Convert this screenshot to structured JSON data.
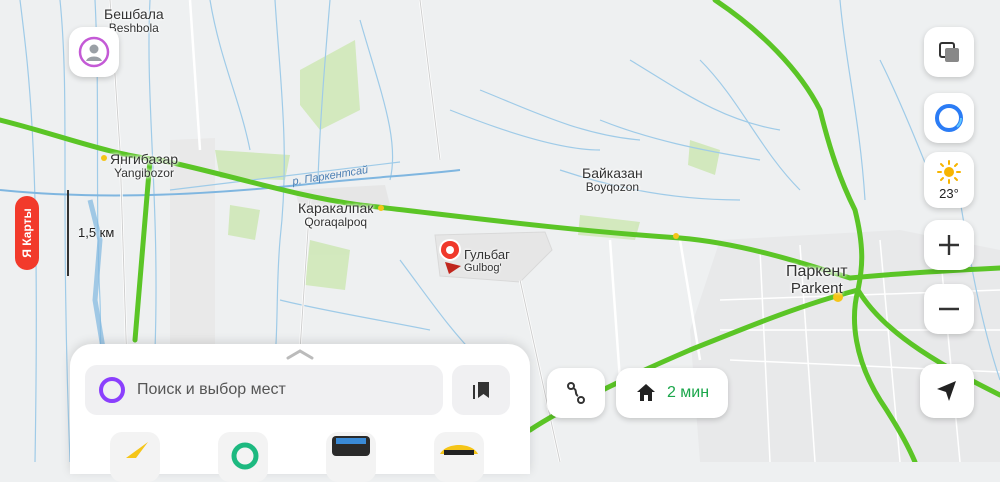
{
  "places": {
    "beshbala": {
      "ru": "Бешбала",
      "lat": "Beshbola"
    },
    "yangibazar": {
      "ru": "Янгибазар",
      "lat": "Yangibozor"
    },
    "karakalpak": {
      "ru": "Каракалпак",
      "lat": "Qoraqalpoq"
    },
    "baykazan": {
      "ru": "Байказан",
      "lat": "Boyqozon"
    },
    "parkent": {
      "ru": "Паркент",
      "lat": "Parkent"
    },
    "gulbag": {
      "ru": "Гульбаг",
      "lat": "Gulbog'"
    }
  },
  "river_label": "р. Паркентсай",
  "scale": {
    "label": "1,5 км"
  },
  "brand_badge": "Я Карты",
  "weather": {
    "temp": "23°",
    "icon": "sun-icon"
  },
  "search": {
    "placeholder": "Поиск и выбор мест"
  },
  "route": {
    "time": "2 мин",
    "icon": "home-icon"
  },
  "colors": {
    "traffic_green": "#5bc526",
    "brand_red": "#f23a2b",
    "alice_purple": "#8b3ffd",
    "route_green": "#1aa64a"
  }
}
